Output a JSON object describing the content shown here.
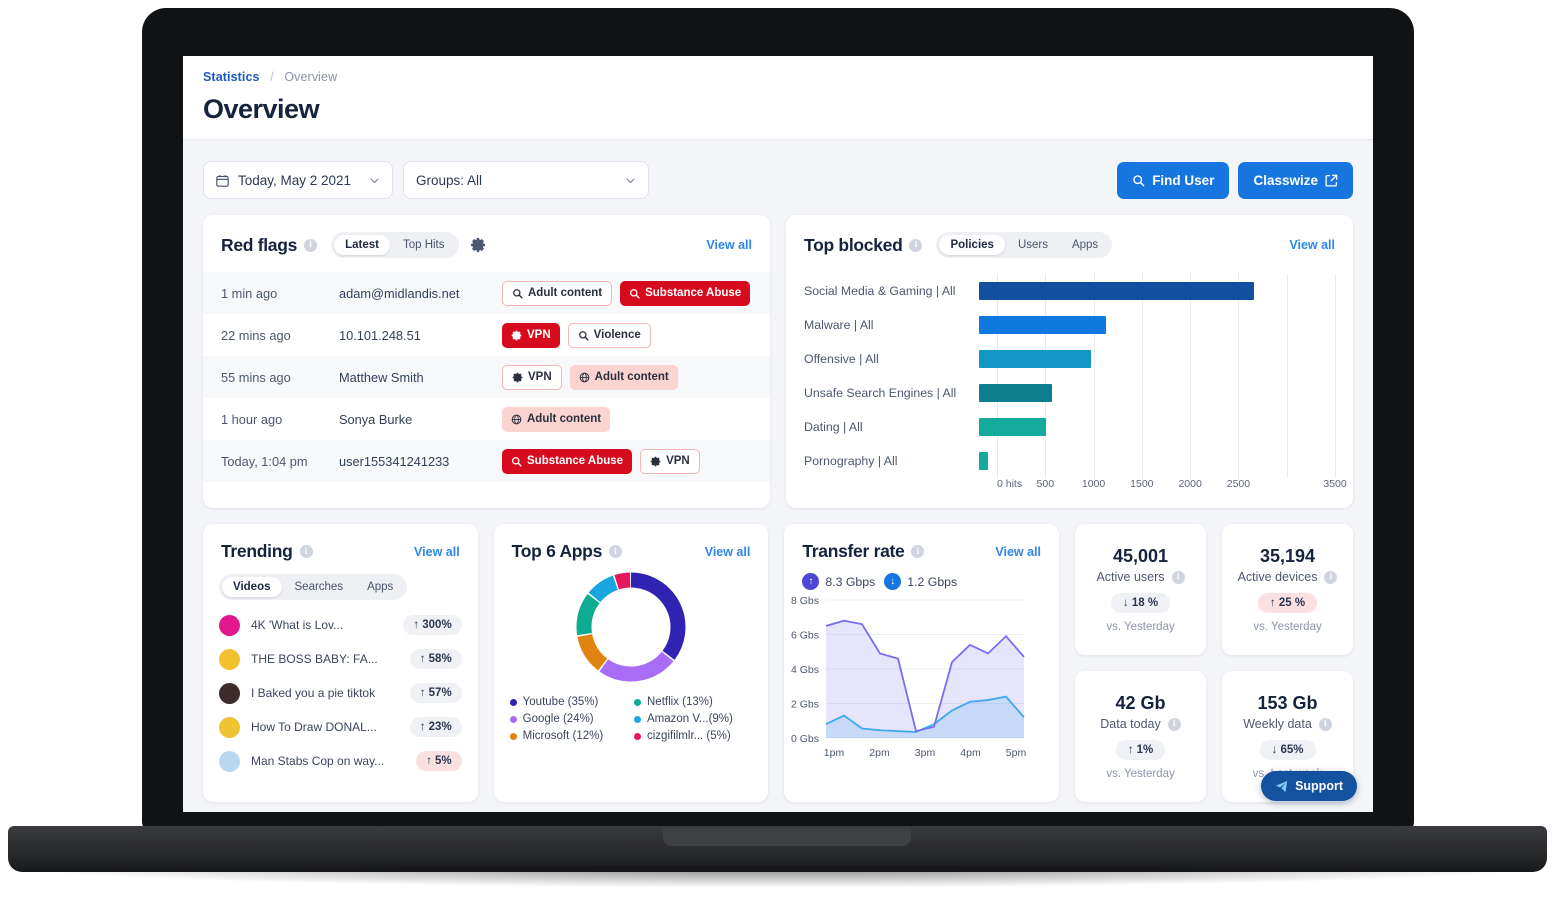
{
  "breadcrumb": {
    "root": "Statistics",
    "separator": "/",
    "current": "Overview"
  },
  "page_title": "Overview",
  "toolbar": {
    "date_filter": "Today, May 2 2021",
    "group_filter": "Groups: All",
    "find_user_label": "Find User",
    "classwize_label": "Classwize"
  },
  "red_flags": {
    "title": "Red flags",
    "tabs": [
      {
        "label": "Latest",
        "active": true
      },
      {
        "label": "Top Hits",
        "active": false
      }
    ],
    "view_all": "View all",
    "rows": [
      {
        "time": "1 min ago",
        "user": "adam@midlandis.net",
        "tags": [
          {
            "label": "Adult content",
            "icon": "search-icon",
            "style": "outline"
          },
          {
            "label": "Substance Abuse",
            "icon": "search-icon",
            "style": "solid"
          }
        ]
      },
      {
        "time": "22 mins ago",
        "user": "10.101.248.51",
        "tags": [
          {
            "label": "VPN",
            "icon": "gear-icon",
            "style": "solid"
          },
          {
            "label": "Violence",
            "icon": "search-icon",
            "style": "outline"
          }
        ]
      },
      {
        "time": "55 mins ago",
        "user": "Matthew Smith",
        "tags": [
          {
            "label": "VPN",
            "icon": "gear-icon",
            "style": "outline"
          },
          {
            "label": "Adult content",
            "icon": "globe-icon",
            "style": "soft"
          }
        ]
      },
      {
        "time": "1 hour ago",
        "user": "Sonya Burke",
        "tags": [
          {
            "label": "Adult content",
            "icon": "globe-icon",
            "style": "soft"
          }
        ]
      },
      {
        "time": "Today, 1:04 pm",
        "user": "user155341241233",
        "tags": [
          {
            "label": "Substance Abuse",
            "icon": "search-icon",
            "style": "solid"
          },
          {
            "label": "VPN",
            "icon": "gear-icon",
            "style": "outline"
          }
        ]
      }
    ]
  },
  "top_blocked": {
    "title": "Top blocked",
    "tabs": [
      {
        "label": "Policies",
        "active": true
      },
      {
        "label": "Users",
        "active": false
      },
      {
        "label": "Apps",
        "active": false
      }
    ],
    "view_all": "View all",
    "chart_data": {
      "type": "bar",
      "orientation": "horizontal",
      "title": "Top blocked",
      "xlabel": "",
      "ylabel": "",
      "xlim": [
        0,
        3500
      ],
      "grid": true,
      "categories": [
        "Social Media & Gaming | All",
        "Malware | All",
        "Offensive | All",
        "Unsafe Search Engines | All",
        "Dating | All",
        "Pornography | All"
      ],
      "values": [
        2700,
        1250,
        1100,
        720,
        660,
        90
      ],
      "colors": [
        "#10509e",
        "#0f79e0",
        "#1296c4",
        "#0c7e8e",
        "#14ab9c",
        "#14ab9c"
      ],
      "ticks": [
        "0 hits",
        "500",
        "1000",
        "1500",
        "2000",
        "2500",
        "3500"
      ],
      "tick_values": [
        0,
        500,
        1000,
        1500,
        2000,
        2500,
        3000,
        3500
      ],
      "tick_labels": [
        "0 hits",
        "500",
        "1000",
        "1500",
        "2000",
        "2500",
        "3500"
      ]
    }
  },
  "trending": {
    "title": "Trending",
    "view_all": "View all",
    "tabs": [
      {
        "label": "Videos",
        "active": true
      },
      {
        "label": "Searches",
        "active": false
      },
      {
        "label": "Apps",
        "active": false
      }
    ],
    "items": [
      {
        "name": "4K 'What is Lov...",
        "change": "↑ 300%",
        "warn": false,
        "thumb": "#e5178e"
      },
      {
        "name": "THE BOSS BABY: FA...",
        "change": "↑ 58%",
        "warn": false,
        "thumb": "#f2c12e"
      },
      {
        "name": "I Baked you a pie tiktok",
        "change": "↑ 57%",
        "warn": false,
        "thumb": "#3b2b2b"
      },
      {
        "name": "How To Draw DONAL...",
        "change": "↑ 23%",
        "warn": false,
        "thumb": "#f0c330"
      },
      {
        "name": "Man Stabs Cop on way...",
        "change": "↑ 5%",
        "warn": true,
        "thumb": "#b9d8ef"
      }
    ]
  },
  "top_apps": {
    "title": "Top 6 Apps",
    "view_all": "View all",
    "chart_data": {
      "type": "pie",
      "title": "Top 6 Apps",
      "labels": [
        "Youtube",
        "Google",
        "Microsoft",
        "Netflix",
        "Amazon V...",
        "cizgifilmlr..."
      ],
      "legend_labels": [
        "Youtube (35%)",
        "Google (24%)",
        "Microsoft (12%)",
        "Netflix (13%)",
        "Amazon V...(9%)",
        "cizgifilmlr... (5%)"
      ],
      "values": [
        35,
        24,
        12,
        13,
        9,
        5
      ],
      "colors": [
        "#3023b4",
        "#a96cf5",
        "#e0840f",
        "#0faa92",
        "#18a5e0",
        "#e51croj"
      ],
      "slice_colors": [
        "#3023b4",
        "#a96cf5",
        "#e0840f",
        "#0faa92",
        "#18a5e0",
        "#e5175f"
      ],
      "legend_position": "bottom",
      "donut": true
    }
  },
  "transfer_rate": {
    "title": "Transfer rate",
    "view_all": "View all",
    "upload": "8.3 Gbps",
    "download": "1.2 Gbps",
    "chart_data": {
      "type": "area",
      "title": "Transfer rate",
      "xlabel": "",
      "ylabel": "",
      "ylim": [
        0,
        8
      ],
      "ytick_labels": [
        "0 Gbs",
        "2 Gbs",
        "4 Gbs",
        "6 Gbs",
        "8 Gbs"
      ],
      "ytick_values": [
        0,
        2,
        4,
        6,
        8
      ],
      "xtick_labels": [
        "1pm",
        "2pm",
        "3pm",
        "4pm",
        "5pm"
      ],
      "grid": true,
      "series": [
        {
          "name": "Upload",
          "color": "#7b6df0",
          "values": [
            6.5,
            6.8,
            6.6,
            4.9,
            4.6,
            0.4,
            0.65,
            4.4,
            5.4,
            4.9,
            5.9,
            4.7
          ]
        },
        {
          "name": "Download",
          "color": "#31b6ef",
          "values": [
            0.8,
            1.3,
            0.55,
            0.45,
            0.4,
            0.35,
            0.8,
            1.6,
            2.1,
            2.2,
            2.4,
            1.2
          ]
        }
      ]
    }
  },
  "kpis": [
    {
      "value": "45,001",
      "label": "Active users",
      "badge": "↓ 18 %",
      "warn": false,
      "sub": "vs. Yesterday"
    },
    {
      "value": "35,194",
      "label": "Active devices",
      "badge": "↑ 25 %",
      "warn": true,
      "sub": "vs. Yesterday"
    },
    {
      "value": "42 Gb",
      "label": "Data today",
      "badge": "↑ 1%",
      "warn": false,
      "sub": "vs. Yesterday"
    },
    {
      "value": "153 Gb",
      "label": "Weekly data",
      "badge": "↓ 65%",
      "warn": false,
      "sub": "vs. Last week"
    }
  ],
  "support_label": "Support",
  "colors": {
    "accent": "#1675de",
    "danger": "#d60c1e",
    "link": "#2e86ea",
    "title": "#16233f"
  }
}
